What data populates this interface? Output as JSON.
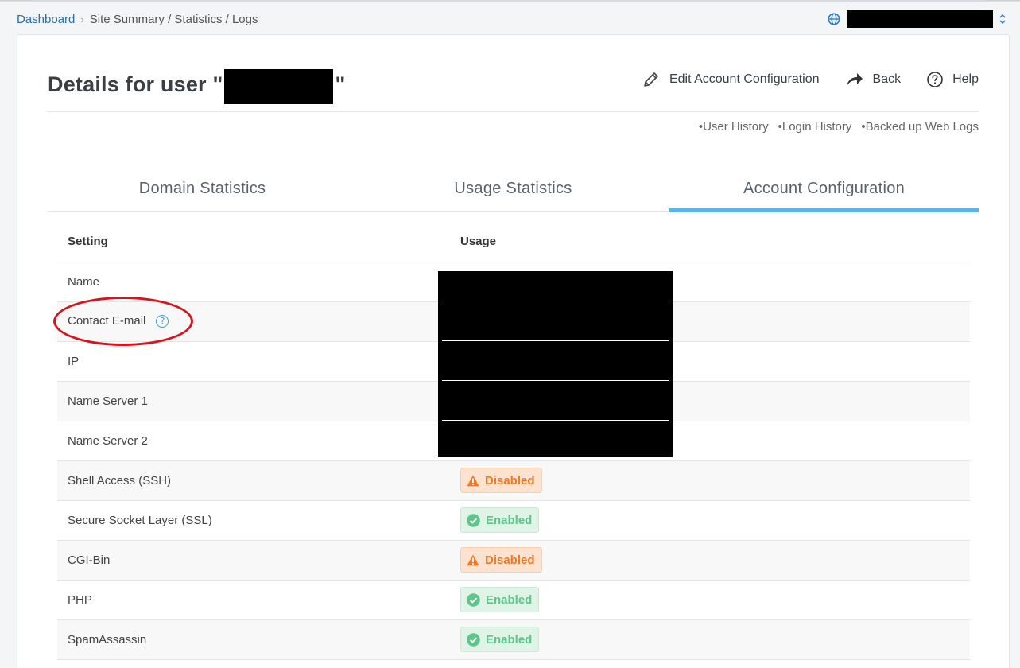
{
  "breadcrumb": {
    "home": "Dashboard",
    "current": "Site Summary / Statistics / Logs"
  },
  "header": {
    "title_prefix": "Details for user \"",
    "title_suffix": "\"",
    "actions": {
      "edit": "Edit Account Configuration",
      "back": "Back",
      "help": "Help"
    }
  },
  "sub_links": [
    "User History",
    "Login History",
    "Backed up Web Logs"
  ],
  "tabs": [
    "Domain Statistics",
    "Usage Statistics",
    "Account Configuration"
  ],
  "active_tab": "Account Configuration",
  "table": {
    "headers": {
      "setting": "Setting",
      "usage": "Usage"
    },
    "rows": [
      {
        "setting": "Name",
        "usage": ""
      },
      {
        "setting": "Contact E-mail",
        "usage": ""
      },
      {
        "setting": "IP",
        "usage": ""
      },
      {
        "setting": "Name Server 1",
        "usage": ""
      },
      {
        "setting": "Name Server 2",
        "usage": ""
      },
      {
        "setting": "Shell Access (SSH)",
        "usage": "Disabled"
      },
      {
        "setting": "Secure Socket Layer (SSL)",
        "usage": "Enabled"
      },
      {
        "setting": "CGI-Bin",
        "usage": "Disabled"
      },
      {
        "setting": "PHP",
        "usage": "Enabled"
      },
      {
        "setting": "SpamAssassin",
        "usage": "Enabled"
      }
    ]
  },
  "colors": {
    "link": "#2a6fa8",
    "tab_active_underline": "#5cb3e6",
    "disabled_bg": "#fde3cf",
    "disabled_text": "#ef7a26",
    "enabled_bg": "#dff3e6",
    "enabled_text": "#5ec58b",
    "annotation": "#d8141b"
  },
  "icons": {
    "domain": "globe-icon",
    "edit": "pencil-icon",
    "back": "back-arrow-icon",
    "help": "help-circle-icon",
    "disabled": "warning-icon",
    "enabled": "check-circle-icon"
  }
}
